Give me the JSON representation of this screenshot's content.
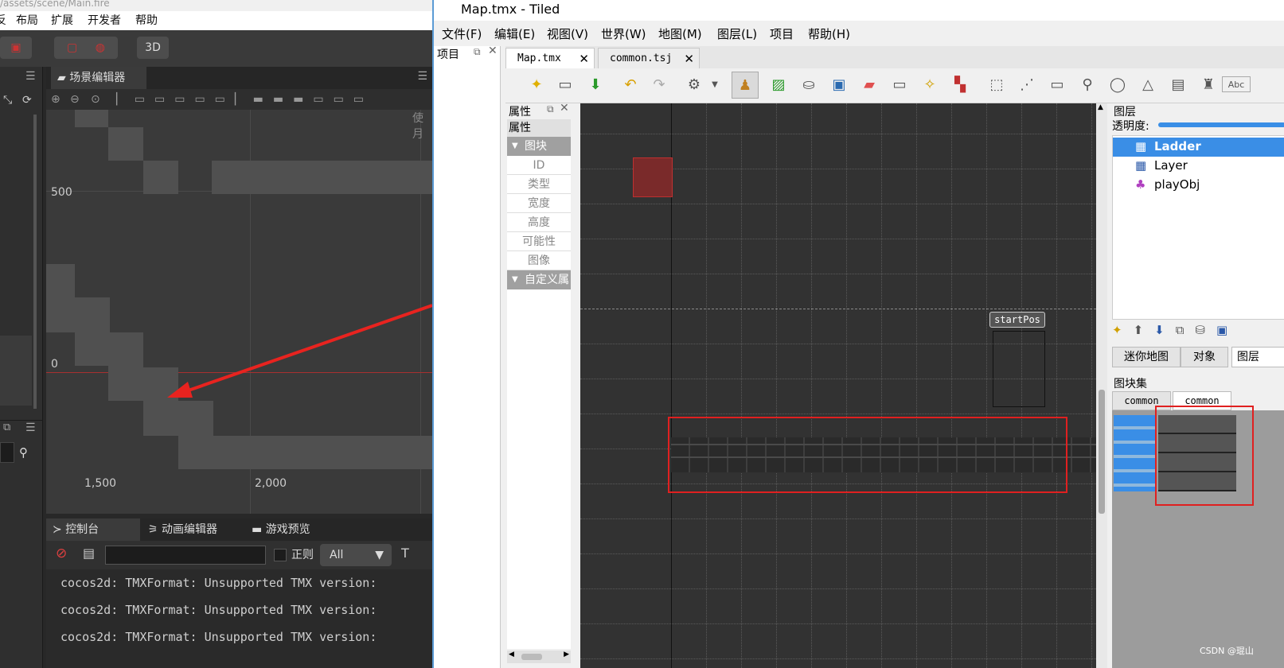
{
  "cocos": {
    "title_partial": "/assets/scene/Main.fire",
    "menu": [
      "反",
      "布局",
      "扩展",
      "开发者",
      "帮助"
    ],
    "toolbar": {
      "btn_3d": "3D"
    },
    "scene_tab": "场景编辑器",
    "scene_hint": "使月",
    "axis": {
      "y_500": "500",
      "y_0": "0",
      "x_1500": "1,500",
      "x_2000": "2,000"
    },
    "console_tabs": [
      "控制台",
      "动画编辑器",
      "游戏预览"
    ],
    "console_toolbar": {
      "regex_label": "正则",
      "level_select": "All"
    },
    "log_lines": [
      "cocos2d: TMXFormat: Unsupported TMX version:",
      "cocos2d: TMXFormat: Unsupported TMX version:",
      "cocos2d: TMXFormat: Unsupported TMX version:"
    ]
  },
  "tiled": {
    "window_title": "Map.tmx - Tiled",
    "menu": [
      "文件(F)",
      "编辑(E)",
      "视图(V)",
      "世界(W)",
      "地图(M)",
      "图层(L)",
      "项目",
      "帮助(H)"
    ],
    "project_panel_title": "项目",
    "doc_tabs": [
      "Map.tmx",
      "common.tsj"
    ],
    "properties": {
      "panel_title": "属性",
      "header": "属性",
      "group_tile": "图块",
      "rows": [
        "ID",
        "类型",
        "宽度",
        "高度",
        "可能性",
        "图像"
      ],
      "group_custom": "自定义属"
    },
    "map": {
      "object_label": "startPos"
    },
    "layers": {
      "panel_title": "图层",
      "opacity_label": "透明度:",
      "items": [
        "Ladder",
        "Layer",
        "playObj"
      ]
    },
    "bottom_tabs": [
      "迷你地图",
      "对象",
      "图层"
    ],
    "tilesets": {
      "panel_title": "图块集",
      "tabs": [
        "common",
        "common"
      ]
    },
    "watermark": "CSDN @琨山",
    "colors": {
      "selection": "#3a8ee6",
      "highlight_box": "#e02020"
    }
  }
}
